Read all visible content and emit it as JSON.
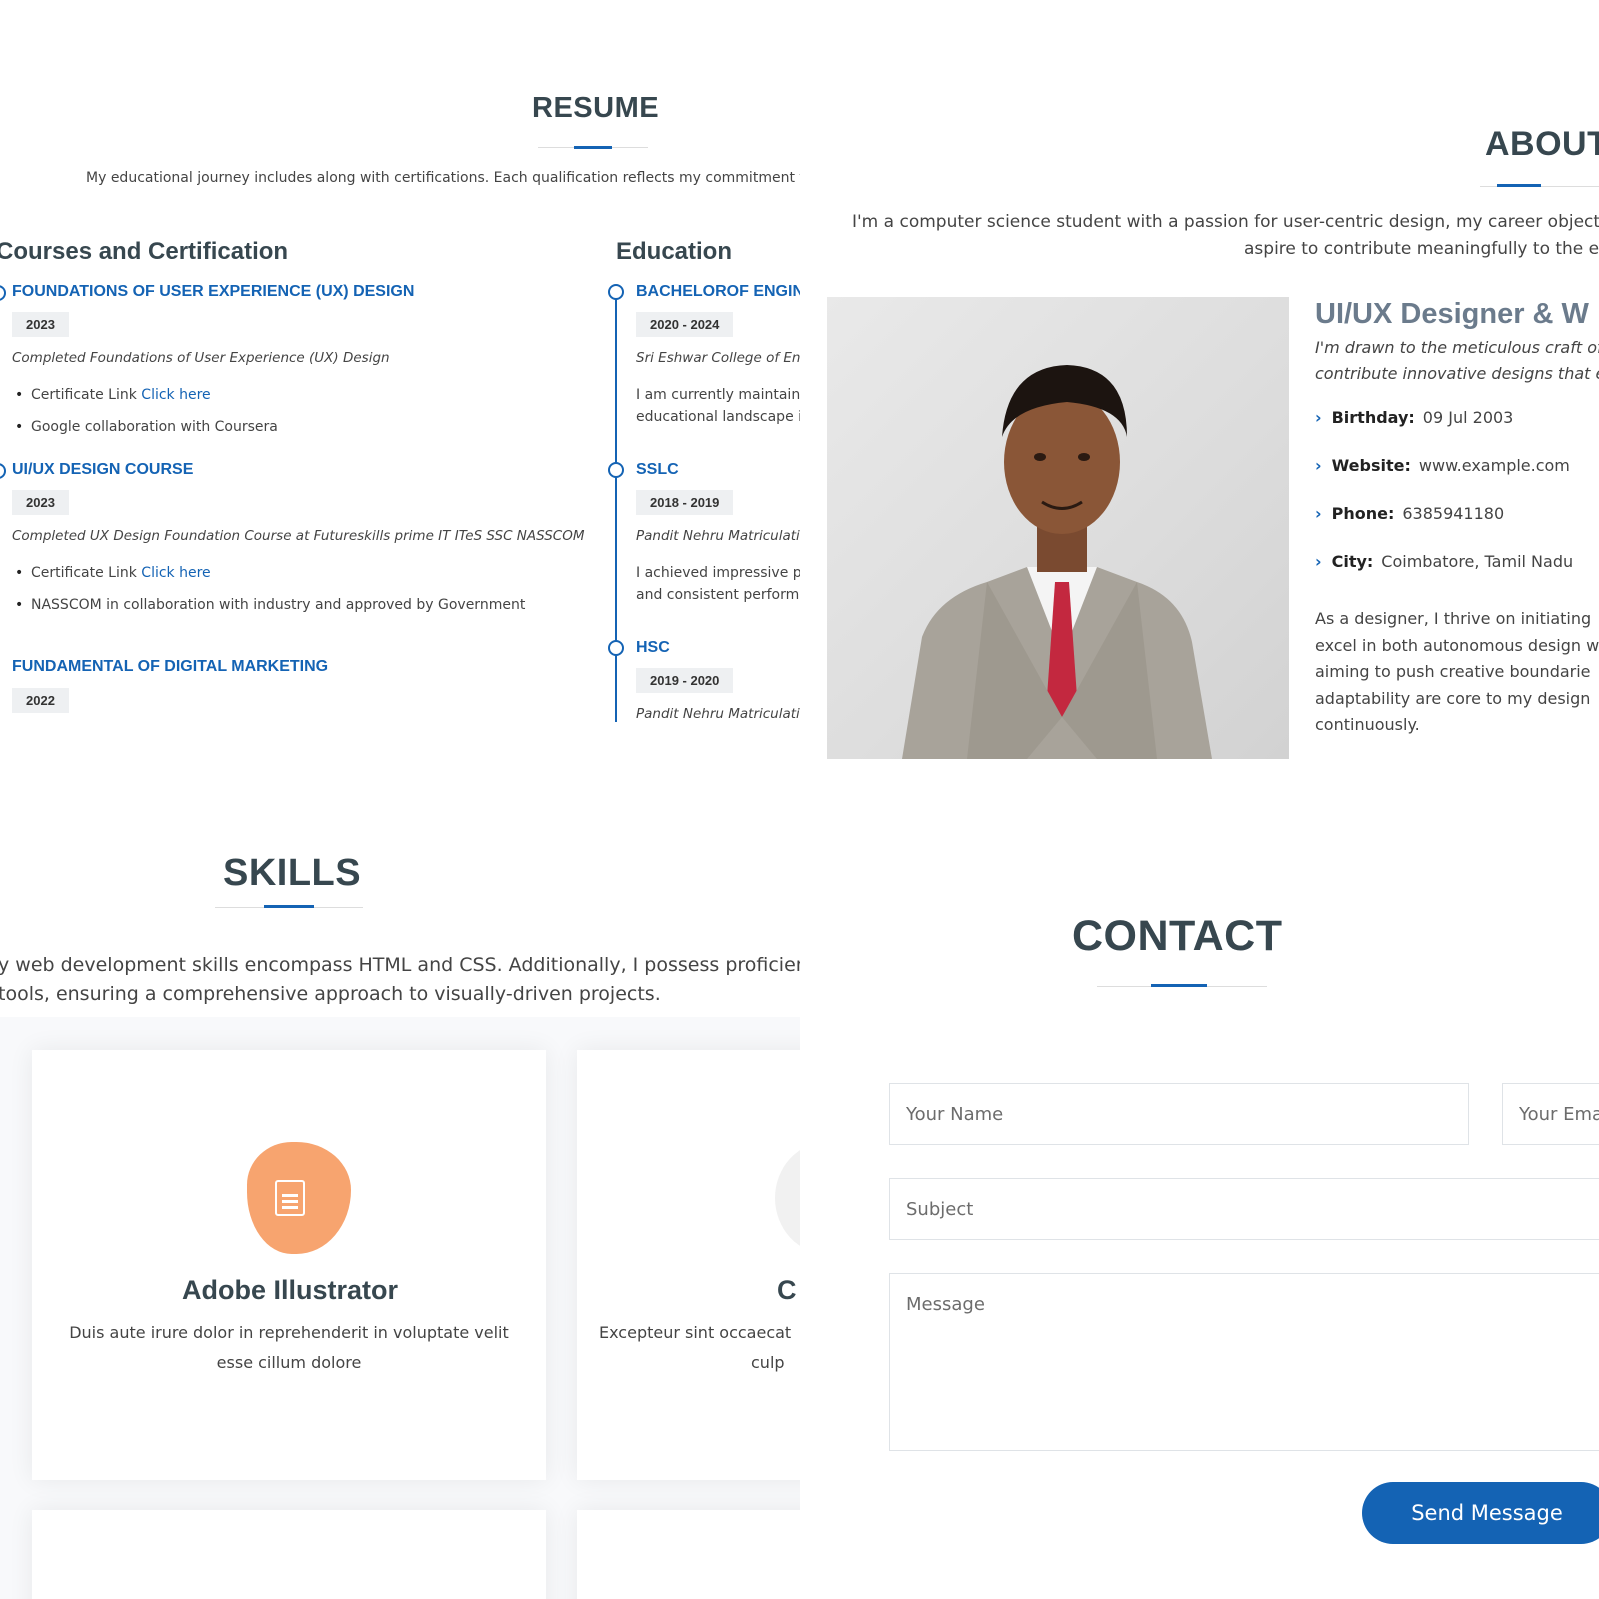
{
  "colors": {
    "accent": "#1463b4",
    "heading": "#37474f",
    "skill_icon": "#f7a46f"
  },
  "resume": {
    "title": "RESUME",
    "intro": "My educational journey includes along with certifications. Each qualification reflects my commitment t",
    "courses_heading": "Courses and Certification",
    "education_heading": "Education",
    "courses": [
      {
        "title": "FOUNDATIONS OF USER EXPERIENCE (UX) DESIGN",
        "year": "2023",
        "summary": "Completed Foundations of User Experience (UX) Design",
        "bullets": [
          {
            "text": "Certificate Link ",
            "link": "Click here"
          },
          {
            "text": "Google collaboration with Coursera"
          }
        ]
      },
      {
        "title": "UI/UX DESIGN COURSE",
        "year": "2023",
        "summary": "Completed UX Design Foundation Course at Futureskills prime IT ITeS SSC NASSCOM",
        "bullets": [
          {
            "text": "Certificate Link ",
            "link": "Click here"
          },
          {
            "text": "NASSCOM in collaboration with industry and approved by Government"
          }
        ]
      },
      {
        "title": "FUNDAMENTAL OF DIGITAL MARKETING",
        "year": "2022"
      }
    ],
    "education": [
      {
        "title": "BACHELOROF ENGIN",
        "year": "2020 - 2024",
        "school": "Sri Eshwar College of Eng",
        "lines": [
          "I am currently maintain",
          "educational landscape i"
        ]
      },
      {
        "title": "SSLC",
        "year": "2018 - 2019",
        "school": "Pandit Nehru Matriculati",
        "lines": [
          "I achieved impressive p",
          "and consistent perform"
        ]
      },
      {
        "title": "HSC",
        "year": "2019 - 2020",
        "school": "Pandit Nehru Matriculati"
      }
    ]
  },
  "about": {
    "title": "ABOUT",
    "intro_lines": [
      "I'm a computer science student with a passion for user-centric design, my career objective",
      "aspire to contribute meaningfully to the ev"
    ],
    "photo_icon": "portrait-photo",
    "role": "UI/UX Designer & W",
    "role_lines": [
      "I'm drawn to the meticulous craft of",
      "contribute innovative designs that el"
    ],
    "info": [
      {
        "label": "Birthday:",
        "value": "09 Jul 2003"
      },
      {
        "label": "Website:",
        "value": "www.example.com"
      },
      {
        "label": "Phone:",
        "value": "6385941180"
      },
      {
        "label": "City:",
        "value": "Coimbatore, Tamil Nadu"
      }
    ],
    "para_lines": [
      "As a designer, I thrive on initiating",
      "excel in both autonomous design w",
      "aiming to push creative boundarie",
      "adaptability are core to my design",
      "continuously."
    ]
  },
  "skills": {
    "title": "SKILLS",
    "intro_lines": [
      "y web development skills encompass HTML and CSS. Additionally, I possess proficiency",
      " tools, ensuring a comprehensive approach to visually-driven projects."
    ],
    "cards": [
      {
        "icon": "document-icon",
        "title": "Adobe Illustrator",
        "desc_lines": [
          "Duis aute irure dolor in reprehenderit in voluptate velit",
          "esse cillum dolore"
        ]
      },
      {
        "title": "C",
        "desc_lines": [
          "Excepteur sint occaecat",
          "culp"
        ]
      }
    ]
  },
  "contact": {
    "title": "CONTACT",
    "name_placeholder": "Your Name",
    "email_placeholder": "Your Ema",
    "subject_placeholder": "Subject",
    "message_placeholder": "Message",
    "send_label": "Send Message"
  }
}
